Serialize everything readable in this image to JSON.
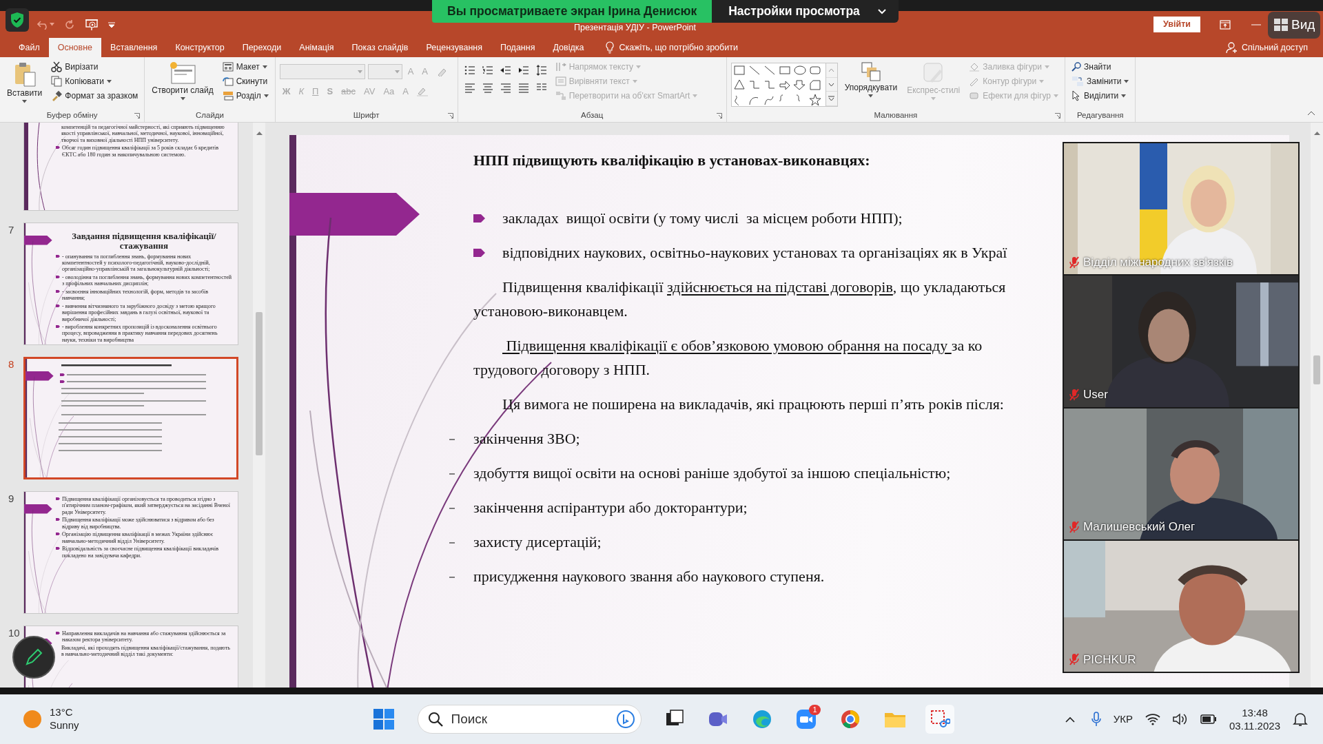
{
  "share_banner": {
    "message": "Вы просматриваете экран Ірина Денисюк",
    "settings_button": "Настройки просмотра"
  },
  "title_bar": {
    "title": "Презентація УДІУ  -  PowerPoint",
    "sign_in": "Увійти",
    "view_button": "Вид"
  },
  "ribbon_tabs": [
    {
      "label": "Файл",
      "selected": false
    },
    {
      "label": "Основне",
      "selected": true
    },
    {
      "label": "Вставлення",
      "selected": false
    },
    {
      "label": "Конструктор",
      "selected": false
    },
    {
      "label": "Переходи",
      "selected": false
    },
    {
      "label": "Анімація",
      "selected": false
    },
    {
      "label": "Показ слайдів",
      "selected": false
    },
    {
      "label": "Рецензування",
      "selected": false
    },
    {
      "label": "Подання",
      "selected": false
    },
    {
      "label": "Довідка",
      "selected": false
    }
  ],
  "tell_me": "Скажіть, що потрібно зробити",
  "share": "Спільний доступ",
  "ribbon_groups": [
    {
      "kind": "buttons",
      "title": "Буфер обміну",
      "launcher": true,
      "columns": [
        [
          {
            "label": "Вставити",
            "kind": "large",
            "dropdown": true,
            "disabled": false
          }
        ],
        [
          {
            "label": "Вирізати",
            "kind": "small",
            "dropdown": false,
            "disabled": false
          },
          {
            "label": "Копіювати",
            "kind": "small",
            "dropdown": true,
            "disabled": false
          },
          {
            "label": "Формат за зразком",
            "kind": "small",
            "dropdown": false,
            "disabled": false
          }
        ]
      ]
    },
    {
      "kind": "buttons",
      "title": "Слайди",
      "columns": [
        [
          {
            "label": "Створити слайд",
            "kind": "large",
            "dropdown": true,
            "disabled": false
          }
        ],
        [
          {
            "label": "Макет",
            "kind": "small",
            "dropdown": true,
            "disabled": false
          },
          {
            "label": "Скинути",
            "kind": "small",
            "dropdown": false,
            "disabled": false
          },
          {
            "label": "Розділ",
            "kind": "small",
            "dropdown": true,
            "disabled": false
          }
        ]
      ]
    },
    {
      "kind": "font",
      "title": "Шрифт",
      "launcher": true,
      "glyph_rows": [
        [
          {
            "text": "A",
            "disabled": true
          },
          {
            "text": "A",
            "disabled": true
          }
        ],
        [
          {
            "text": "Ж",
            "disabled": true
          },
          {
            "text": "К",
            "disabled": true
          },
          {
            "text": "П",
            "disabled": true
          },
          {
            "text": "S",
            "disabled": true
          },
          {
            "text": "abc",
            "disabled": true
          },
          {
            "text": "AV",
            "disabled": true
          },
          {
            "text": "Aa",
            "disabled": true
          },
          {
            "text": "A",
            "disabled": true
          }
        ]
      ]
    },
    {
      "kind": "paragraph",
      "title": "Абзац",
      "launcher": true,
      "columns": [
        [
          {
            "label": "Напрямок тексту",
            "kind": "small",
            "dropdown": true,
            "disabled": true
          },
          {
            "label": "Вирівняти текст",
            "kind": "small",
            "dropdown": true,
            "disabled": true
          },
          {
            "label": "Перетворити на об'єкт SmartArt",
            "kind": "small",
            "dropdown": true,
            "disabled": true
          }
        ]
      ]
    },
    {
      "kind": "drawing",
      "title": "Малювання",
      "launcher": true,
      "columns": [
        [
          {
            "label": "Упорядкувати",
            "kind": "large",
            "dropdown": true,
            "disabled": false
          }
        ],
        [
          {
            "label": "Експрес-стилі",
            "kind": "large",
            "dropdown": true,
            "disabled": true
          }
        ],
        [
          {
            "label": "Заливка фігури",
            "kind": "small",
            "dropdown": true,
            "disabled": true
          },
          {
            "label": "Контур фігури",
            "kind": "small",
            "dropdown": true,
            "disabled": true
          },
          {
            "label": "Ефекти для фігур",
            "kind": "small",
            "dropdown": true,
            "disabled": true
          }
        ]
      ]
    },
    {
      "kind": "buttons",
      "title": "Редагування",
      "columns": [
        [
          {
            "label": "Знайти",
            "kind": "small",
            "dropdown": false,
            "disabled": false
          },
          {
            "label": "Замінити",
            "kind": "small",
            "dropdown": true,
            "disabled": false
          },
          {
            "label": "Виділити",
            "kind": "small",
            "dropdown": true,
            "disabled": false
          }
        ]
      ]
    }
  ],
  "thumbnails": [
    {
      "kind": "text",
      "selected": false,
      "items": [
        {
          "kind": "paragraph",
          "text": "компетенцій та педагогічної майстерності, які сприяють підвищенню якості управлінської, навчальної, методичної, наукової, інноваційної, творчої та виховної діяльності НПП університету."
        },
        {
          "kind": "bullet",
          "text": "Обсяг годин підвищення кваліфікації за 5 років складає 6 кредитів ЄКТС або 180 годин за накопичувальною системою."
        }
      ]
    },
    {
      "kind": "text",
      "number": "7",
      "selected": false,
      "title": "Завдання підвищення кваліфікації/стажування",
      "items": [
        {
          "kind": "bullet",
          "text": "- опанування та поглиблення знань, формування нових компетентностей у психолого-педагогічній, науково-дослідній, організаційно-управлінській та загальнокультурній діяльності;"
        },
        {
          "kind": "bullet",
          "text": "- оволодіння та поглиблення знань, формування нових компетентностей з профільних навчальних дисциплін;"
        },
        {
          "kind": "bullet",
          "text": "- засвоєння інноваційних технологій, форм, методів та засобів навчання;"
        },
        {
          "kind": "bullet",
          "text": "- вивчення вітчизняного та зарубіжного досвіду з метою кращого вирішення професійних завдань в галузі освітньої, наукової та виробничої діяльності;"
        },
        {
          "kind": "bullet",
          "text": "- вироблення конкретних пропозицій із вдосконалення освітнього процесу, впровадження в практику навчання передових досягнень науки, техніки та виробництва"
        }
      ]
    },
    {
      "kind": "miniature",
      "number": "8",
      "selected": true
    },
    {
      "kind": "text",
      "number": "9",
      "selected": false,
      "items": [
        {
          "kind": "bullet",
          "text": "Підвищення кваліфікації організовується та проводиться згідно з п'ятирічним планом-графіком, який затверджується на засіданні Вченої ради Університету."
        },
        {
          "kind": "bullet",
          "text": "Підвищення кваліфікації може здійснюватися з відривом або без відриву від виробництва."
        },
        {
          "kind": "bullet",
          "text": "Організацію підвищення кваліфікації в межах України здійснює навчально-методичний відділ Університету."
        },
        {
          "kind": "bullet",
          "text": "Відповідальність за своєчасне підвищення кваліфікації викладачів покладено на завідувача кафедри."
        }
      ]
    },
    {
      "kind": "text",
      "number": "10",
      "selected": false,
      "items": [
        {
          "kind": "bullet",
          "text": "Направлення викладачів на навчання або стажування здійснюється за наказом ректора університету."
        },
        {
          "kind": "paragraph",
          "text": "Викладачі, які проходять підвищення кваліфікації/стажування, подають в навчально-методичний відділ такі документи:"
        }
      ]
    }
  ],
  "slide": {
    "title": "НПП підвищують кваліфікацію в установах-виконавцях:",
    "lines": [
      {
        "kind": "bullet",
        "segments": [
          {
            "text": "закладах  вищої освіти (у тому числі  за місцем роботи НПП);",
            "underline": false
          }
        ]
      },
      {
        "kind": "bullet",
        "segments": [
          {
            "text": "відповідних наукових, освітньо-наукових установах та організаціях як в Украї",
            "underline": false
          }
        ]
      },
      {
        "kind": "indent",
        "segments": [
          {
            "text": "Підвищення кваліфікації ",
            "underline": false
          },
          {
            "text": "здійснюється на підставі договорів",
            "underline": true
          },
          {
            "text": ", що укладаються",
            "underline": false
          }
        ]
      },
      {
        "kind": "continuation",
        "segments": [
          {
            "text": "установою-виконавцем.",
            "underline": false
          }
        ]
      },
      {
        "kind": "indent",
        "segments": [
          {
            "text": " Підвищення кваліфікації є обов’язковою умовою обрання на посаду ",
            "underline": true
          },
          {
            "text": "за ко",
            "underline": false
          }
        ]
      },
      {
        "kind": "continuation",
        "segments": [
          {
            "text": "трудового договору з НПП.",
            "underline": false
          }
        ]
      },
      {
        "kind": "indent",
        "segments": [
          {
            "text": "Ця вимога не поширена на викладачів, які працюють перші п’ять років після:",
            "underline": false
          }
        ]
      },
      {
        "kind": "dash",
        "segments": [
          {
            "text": "закінчення ЗВО;",
            "underline": false
          }
        ]
      },
      {
        "kind": "dash",
        "segments": [
          {
            "text": "здобуття вищої освіти на основі раніше здобутої за іншою спеціальністю;",
            "underline": false
          }
        ]
      },
      {
        "kind": "dash",
        "segments": [
          {
            "text": "закінчення аспірантури або докторантури;",
            "underline": false
          }
        ]
      },
      {
        "kind": "dash",
        "segments": [
          {
            "text": "захисту дисертацій;",
            "underline": false
          }
        ]
      },
      {
        "kind": "dash",
        "segments": [
          {
            "text": "присудження наукового звання або наукового ступеня.",
            "underline": false
          }
        ]
      }
    ]
  },
  "participants": [
    {
      "name": "Відділ міжнародних зв'язків",
      "muted": true
    },
    {
      "name": "User",
      "muted": true
    },
    {
      "name": "Малишевський Олег",
      "muted": true
    },
    {
      "name": "PICHKUR",
      "muted": true
    }
  ],
  "taskbar": {
    "temperature": "13°C",
    "weather": "Sunny",
    "search_placeholder": "Поиск",
    "zoom_badge": "1",
    "language": "УКР",
    "time": "13:48",
    "date": "03.11.2023"
  }
}
